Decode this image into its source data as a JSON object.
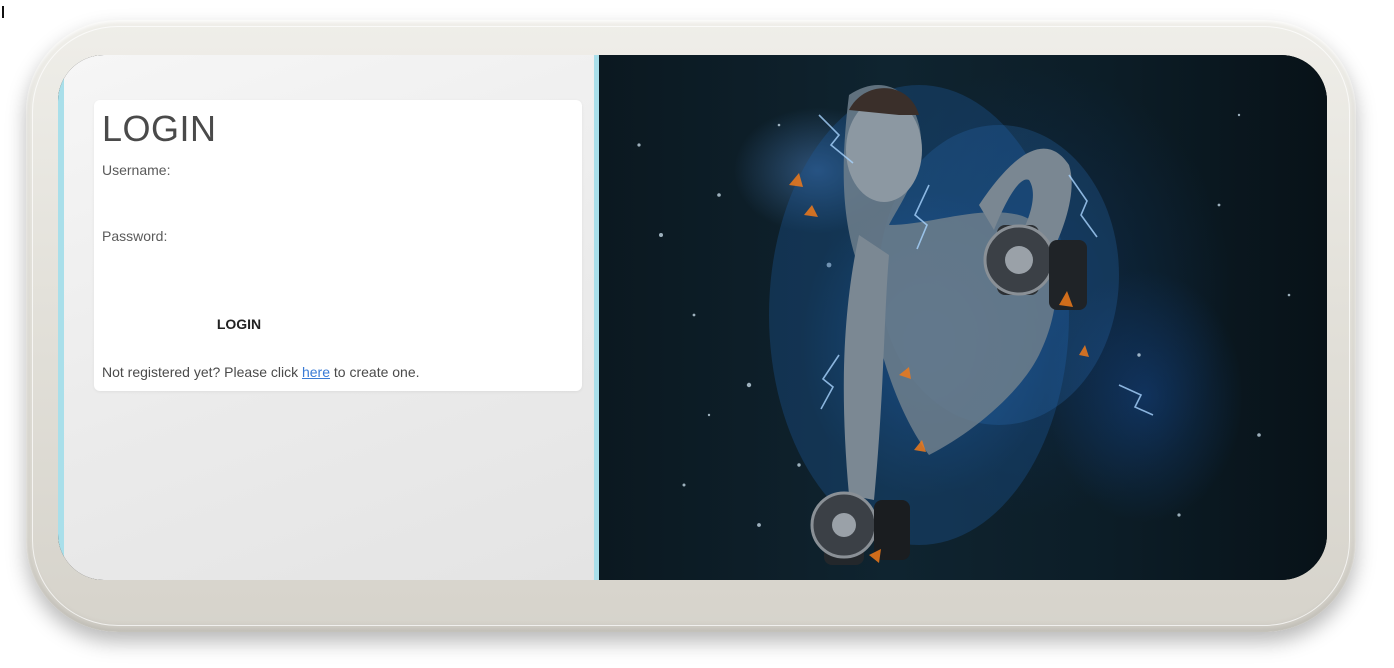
{
  "login": {
    "title": "LOGIN",
    "username_label": "Username:",
    "password_label": "Password:",
    "username_value": "",
    "password_value": "",
    "button_label": "LOGIN",
    "register_prefix": "Not registered yet? Please click ",
    "register_link": "here",
    "register_suffix": " to create one."
  },
  "hero": {
    "image_icon": "athlete-with-dumbbells-image"
  },
  "colors": {
    "accent_strip": "#a9dfea",
    "link": "#3a7bd5",
    "hero_background": "#0c1d27"
  }
}
